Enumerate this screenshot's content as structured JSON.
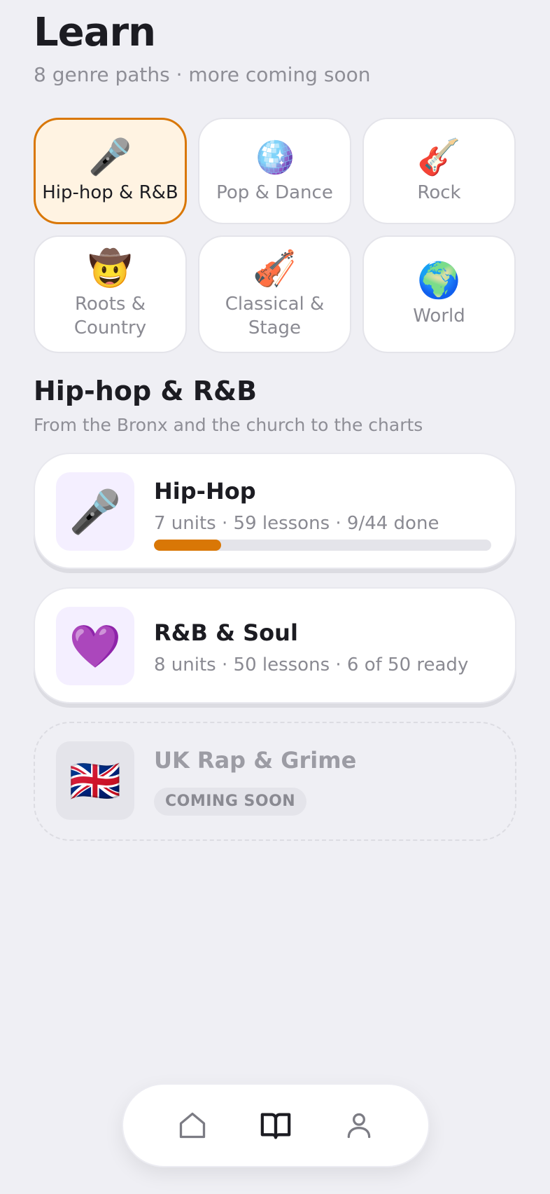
{
  "header": {
    "title": "Learn",
    "subtitle": "8 genre paths · more coming soon"
  },
  "genres": [
    {
      "emoji": "🎤",
      "label": "Hip-hop & R&B",
      "selected": true
    },
    {
      "emoji": "🪩",
      "label": "Pop & Dance",
      "selected": false
    },
    {
      "emoji": "🎸",
      "label": "Rock",
      "selected": false
    },
    {
      "emoji": "🤠",
      "label": "Roots &\nCountry",
      "selected": false
    },
    {
      "emoji": "🎻",
      "label": "Classical &\nStage",
      "selected": false
    },
    {
      "emoji": "🌍",
      "label": "World",
      "selected": false
    }
  ],
  "section": {
    "title": "Hip-hop & R&B",
    "description": "From the Bronx and the church to the charts"
  },
  "paths": [
    {
      "emoji": "🎤",
      "name": "Hip-Hop",
      "meta": "7 units · 59 lessons · 9/44 done",
      "progress": 0.2
    },
    {
      "emoji": "💜",
      "name": "R&B & Soul",
      "meta": "8 units · 50 lessons · 6 of 50 ready"
    },
    {
      "emoji": "🇬🇧",
      "name": "UK Rap & Grime",
      "badge": "COMING SOON"
    }
  ],
  "nav": {
    "items": [
      {
        "icon": "home-icon",
        "active": false
      },
      {
        "icon": "book-icon",
        "active": true
      },
      {
        "icon": "profile-icon",
        "active": false
      }
    ],
    "colors": {
      "active": "#1c1c22",
      "inactive": "#7c7c84"
    }
  },
  "colors": {
    "accent": "#d97706",
    "selected_bg": "#fff3e2",
    "background": "#efeff4"
  }
}
